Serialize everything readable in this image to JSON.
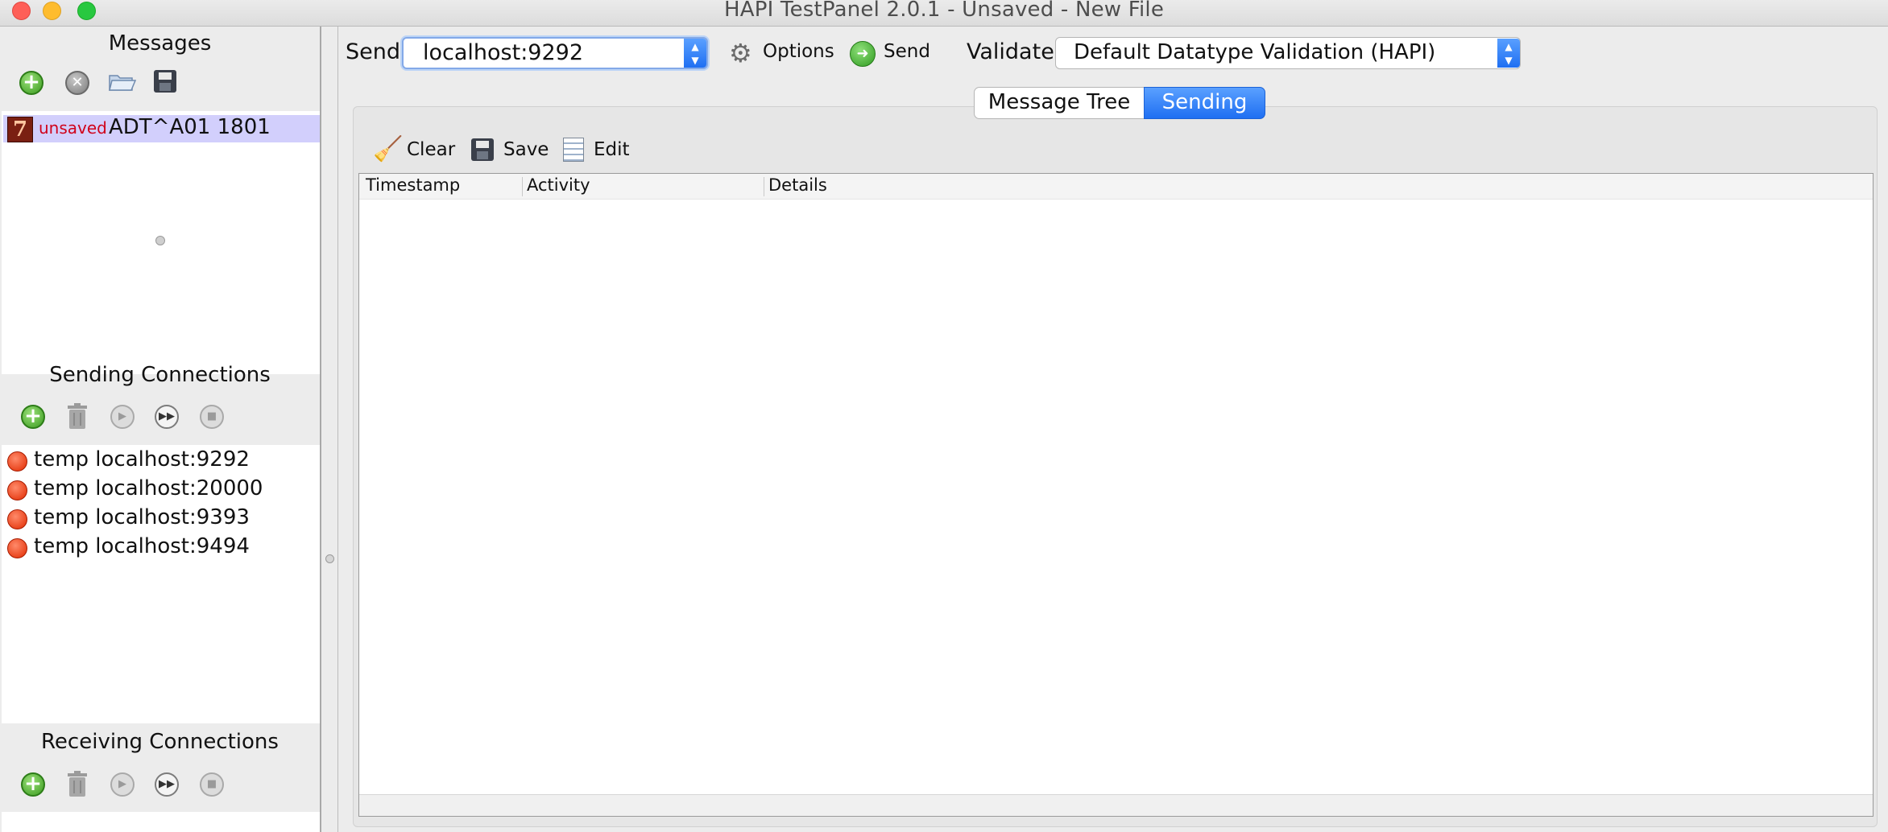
{
  "window": {
    "title": "HAPI TestPanel 2.0.1 - Unsaved - New File"
  },
  "messages": {
    "title": "Messages",
    "toolbar_icons": [
      "add-icon",
      "remove-icon",
      "open-folder-icon",
      "save-icon"
    ],
    "items": [
      {
        "status": "unsaved",
        "name": "ADT^A01 1801",
        "icon": "hl7-message-icon",
        "icon_glyph": "7"
      }
    ]
  },
  "sending_connections": {
    "title": "Sending Connections",
    "toolbar_icons": [
      "add-icon",
      "trash-icon",
      "play-icon",
      "fast-forward-icon",
      "stop-icon"
    ],
    "items": [
      {
        "label": "temp localhost:9292",
        "status_color": "#e12a00"
      },
      {
        "label": "temp localhost:20000",
        "status_color": "#e12a00"
      },
      {
        "label": "temp localhost:9393",
        "status_color": "#e12a00"
      },
      {
        "label": "temp localhost:9494",
        "status_color": "#e12a00"
      }
    ]
  },
  "receiving_connections": {
    "title": "Receiving Connections",
    "toolbar_icons": [
      "add-icon",
      "trash-icon",
      "play-icon",
      "fast-forward-icon",
      "stop-icon"
    ]
  },
  "topbar": {
    "send_label": "Send",
    "send_target": "localhost:9292",
    "options_label": "Options",
    "send_button_label": "Send",
    "validate_label": "Validate",
    "validate_value": "Default Datatype Validation (HAPI)"
  },
  "tabs": [
    {
      "label": "Message Tree",
      "selected": false
    },
    {
      "label": "Sending",
      "selected": true
    }
  ],
  "activity_panel": {
    "toolbar": {
      "clear": "Clear",
      "save": "Save",
      "edit": "Edit"
    },
    "columns": [
      "Timestamp",
      "Activity",
      "Details"
    ],
    "rows": []
  },
  "colors": {
    "accent": "#1f6ff2",
    "selection": "#d2cffc",
    "unsaved": "#d0021b",
    "status_off": "#e12a00"
  }
}
